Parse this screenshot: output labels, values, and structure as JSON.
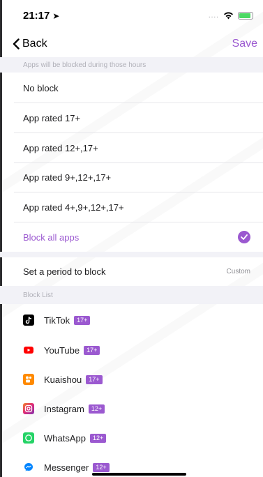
{
  "status_bar": {
    "time": "21:17",
    "location_glyph": "➤",
    "signal": "....",
    "wifi_icon": "wifi-icon",
    "battery_icon": "battery-icon"
  },
  "nav": {
    "back_label": "Back",
    "save_label": "Save"
  },
  "section_blocked_hours": {
    "header": "Apps will be blocked during those hours"
  },
  "age_options": [
    {
      "label": "No block"
    },
    {
      "label": "App rated 17+"
    },
    {
      "label": "App rated 12+,17+"
    },
    {
      "label": "App rated 9+,12+,17+"
    },
    {
      "label": "App rated 4+,9+,12+,17+"
    },
    {
      "label": "Block all apps",
      "selected": true
    }
  ],
  "period": {
    "label": "Set a period to block",
    "value": "Custom"
  },
  "block_list": {
    "header": "Block List",
    "apps": [
      {
        "name": "TikTok",
        "rating": "17+",
        "icon": "tiktok-icon",
        "icon_color": "#000000"
      },
      {
        "name": "YouTube",
        "rating": "17+",
        "icon": "youtube-icon",
        "icon_color": "#ff0000"
      },
      {
        "name": "Kuaishou",
        "rating": "17+",
        "icon": "kuaishou-icon",
        "icon_color": "#ff8a00"
      },
      {
        "name": "Instagram",
        "rating": "12+",
        "icon": "instagram-icon",
        "icon_color": "#c13584"
      },
      {
        "name": "WhatsApp",
        "rating": "12+",
        "icon": "whatsapp-icon",
        "icon_color": "#25d366"
      },
      {
        "name": "Messenger",
        "rating": "12+",
        "icon": "messenger-icon",
        "icon_color": "#0084ff"
      }
    ]
  },
  "colors": {
    "accent": "#9b59d0",
    "section_bg": "#f2f2f7"
  }
}
